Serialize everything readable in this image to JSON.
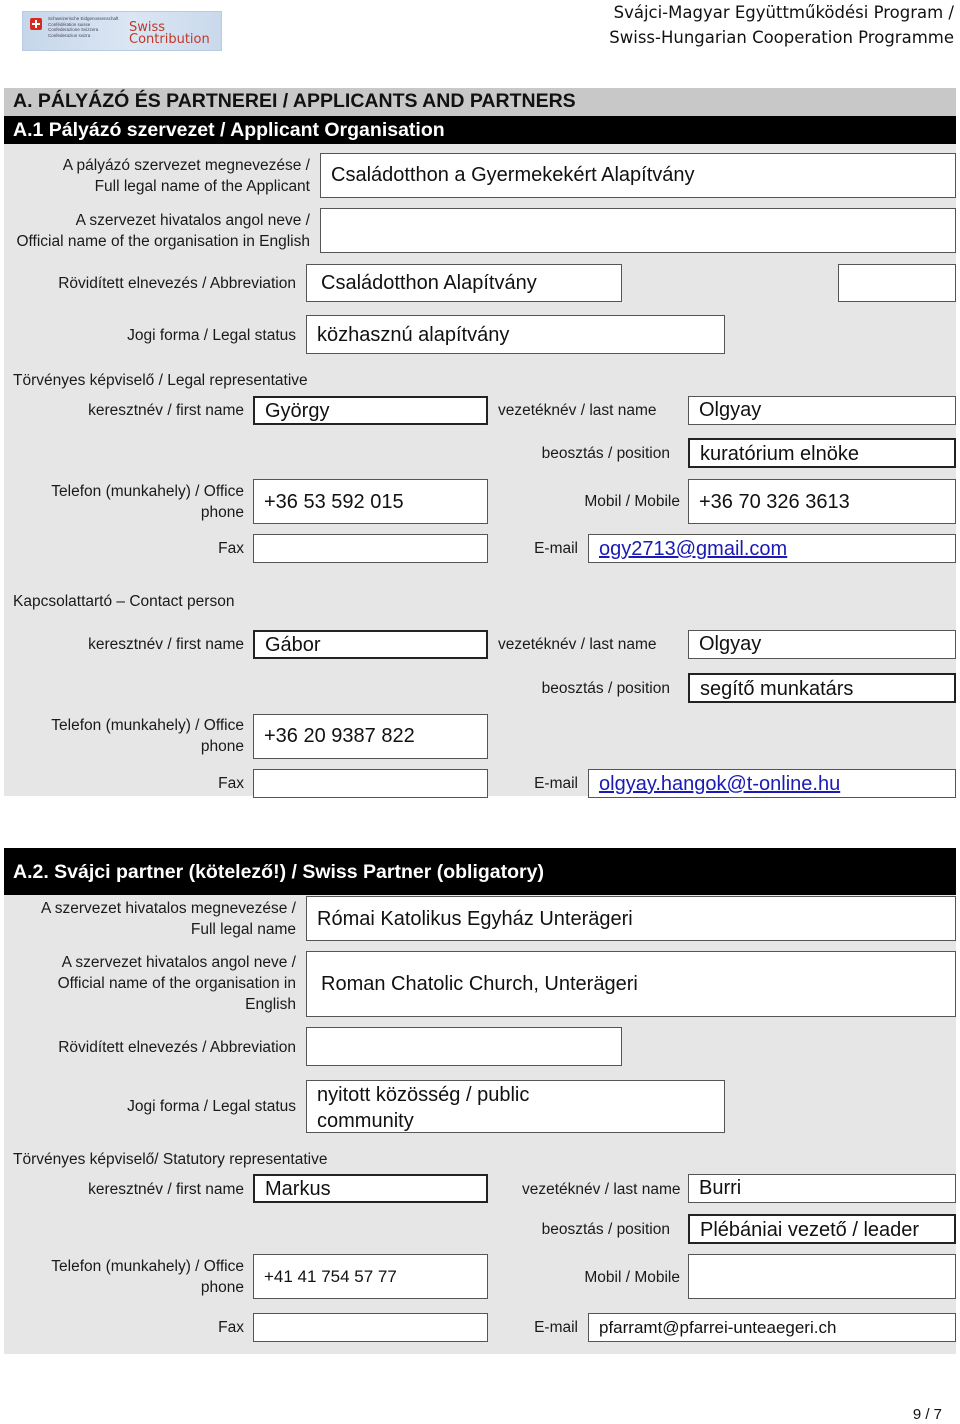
{
  "header": {
    "logo": {
      "lines": [
        "Schweizerische Eidgenossenschaft",
        "Confédération suisse",
        "Confederazione Svizzera",
        "Confederaziun svizra"
      ],
      "brand_line1": "Swiss",
      "brand_line2": "Contribution"
    },
    "programme_line1": "Svájci-Magyar Együttműködési Program /",
    "programme_line2": "Swiss-Hungarian Cooperation Programme"
  },
  "section_a": {
    "title": "A. PÁLYÁZÓ ÉS PARTNEREI / APPLICANTS AND PARTNERS"
  },
  "a1": {
    "title": "A.1 Pályázó szervezet / Applicant Organisation",
    "full_name_label_1": "A pályázó szervezet megnevezése /",
    "full_name_label_2": "Full legal name of the Applicant",
    "full_name_value": "Családotthon a Gyermekekért Alapítvány",
    "english_name_label_1": "A szervezet hivatalos angol neve /",
    "english_name_label_2": "Official name of the organisation in English",
    "english_name_value": "",
    "abbrev_label": "Rövidített elnevezés / Abbreviation",
    "abbrev_value": "Családotthon Alapítvány",
    "abbrev_extra_value": "",
    "legal_status_label": "Jogi forma  / Legal status",
    "legal_status_value": "közhasznú alapítvány",
    "legal_rep": {
      "heading": "Törvényes képviselő / Legal representative",
      "first_name_label": "keresztnév / first name",
      "first_name": "György",
      "last_name_label": "vezetéknév / last name",
      "last_name": "Olgyay",
      "position_label": "beosztás / position",
      "position": "kuratórium elnöke",
      "phone_label_1": "Telefon (munkahely) / Office",
      "phone_label_2": "phone",
      "phone": "+36 53 592 015",
      "mobile_label": "Mobil / Mobile",
      "mobile": "+36 70 326 3613",
      "fax_label": "Fax",
      "fax": "",
      "email_label": "E-mail",
      "email": "ogy2713@gmail.com"
    },
    "contact": {
      "heading": "Kapcsolattartó – Contact person",
      "first_name_label": "keresztnév / first name",
      "first_name": "Gábor",
      "last_name_label": "vezetéknév / last name",
      "last_name": "Olgyay",
      "position_label": "beosztás / position",
      "position": "segítő munkatárs",
      "phone_label_1": "Telefon (munkahely) / Office",
      "phone_label_2": "phone",
      "phone": "+36 20 9387 822",
      "fax_label": "Fax",
      "fax": "",
      "email_label": "E-mail",
      "email": "olgyay.hangok@t-online.hu"
    }
  },
  "a2": {
    "title": "A.2. Svájci partner (kötelező!) / Swiss Partner (obligatory)",
    "full_name_label_1": "A szervezet hivatalos megnevezése /",
    "full_name_label_2": "Full legal name",
    "full_name_value": "Római Katolikus Egyház Unterägeri",
    "english_name_label_1": "A szervezet hivatalos angol neve /",
    "english_name_label_2": "Official name of the organisation in",
    "english_name_label_3": "English",
    "english_name_value": "Roman Chatolic Church, Unterägeri",
    "abbrev_label": "Rövidített elnevezés / Abbreviation",
    "abbrev_value": "",
    "legal_status_label": "Jogi forma  / Legal status",
    "legal_status_value_1": "nyitott közösség / public",
    "legal_status_value_2": "community",
    "statutory_rep": {
      "heading": "Törvényes képviselő/ Statutory representative",
      "first_name_label": "keresztnév / first name",
      "first_name": "Markus",
      "last_name_label": "vezetéknév / last name",
      "last_name": "Burri",
      "position_label": "beosztás / position",
      "position": "Plébániai vezető / leader",
      "phone_label_1": "Telefon (munkahely) / Office",
      "phone_label_2": "phone",
      "phone": "+41 41 754 57 77",
      "mobile_label": "Mobil / Mobile",
      "mobile": "",
      "fax_label": "Fax",
      "fax": "",
      "email_label": "E-mail",
      "email": "pfarramt@pfarrei-unteaegeri.ch"
    }
  },
  "footer": {
    "page": "9 / 7"
  }
}
